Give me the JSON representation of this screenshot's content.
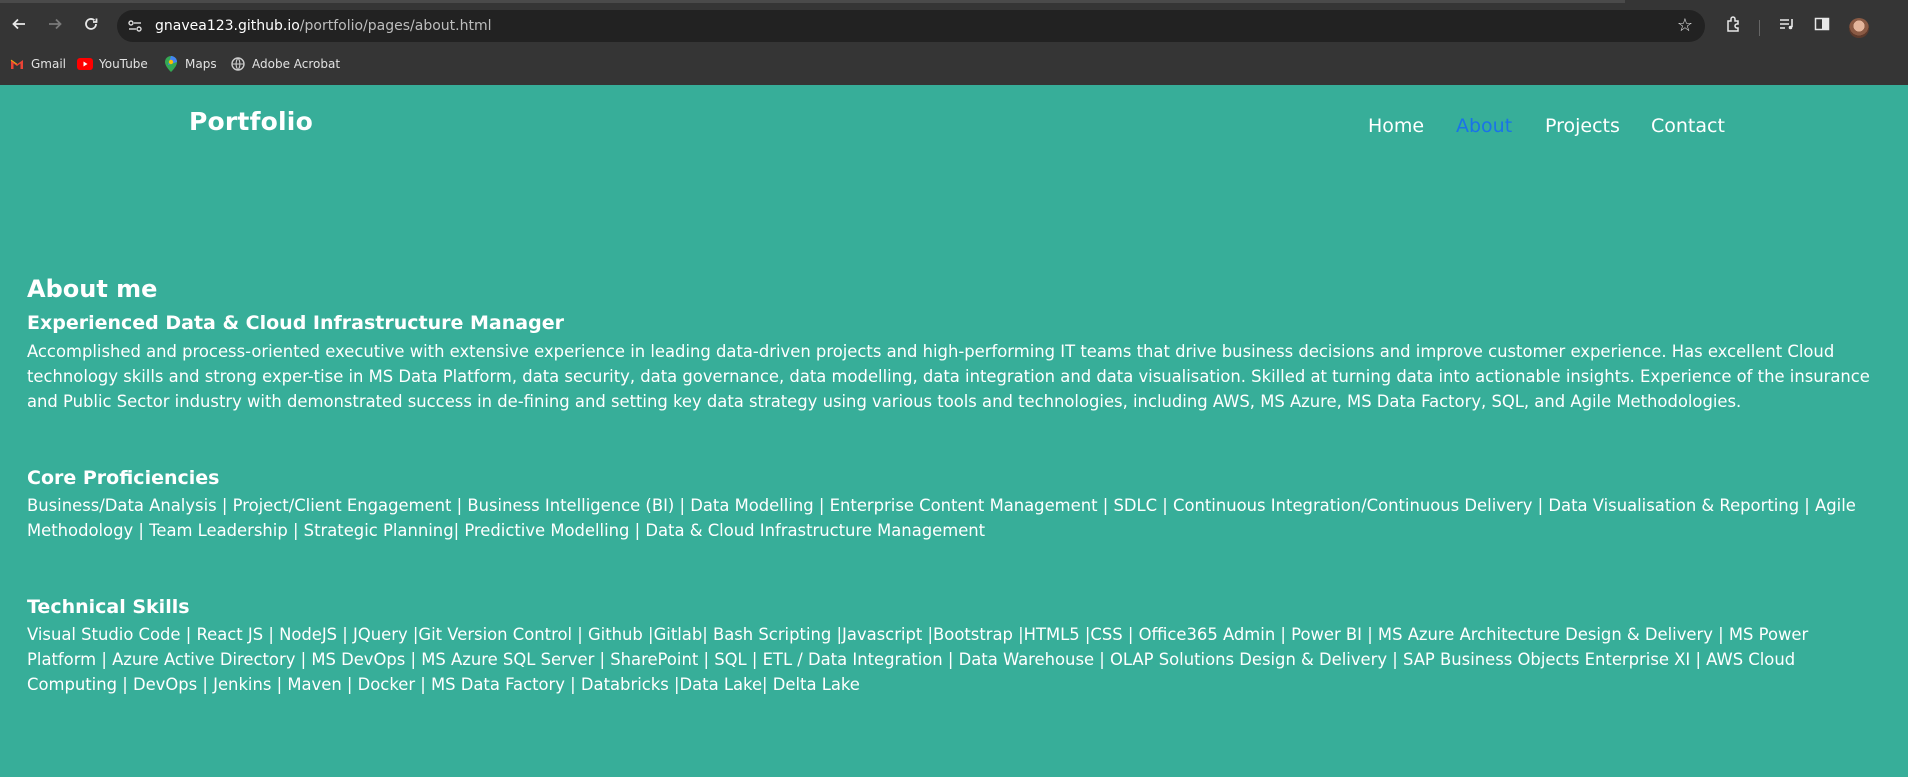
{
  "browser": {
    "url_host": "gnavea123.github.io",
    "url_path": "/portfolio/pages/about.html",
    "bookmarks": [
      {
        "label": "Gmail",
        "icon": "gmail-icon",
        "color": "#ea4335"
      },
      {
        "label": "YouTube",
        "icon": "youtube-icon",
        "color": "#ff0000"
      },
      {
        "label": "Maps",
        "icon": "maps-icon",
        "color": "#34a853"
      },
      {
        "label": "Adobe Acrobat",
        "icon": "globe-icon",
        "color": "#cccccc"
      }
    ]
  },
  "site": {
    "brand": "Portfolio",
    "nav": [
      {
        "label": "Home",
        "active": false
      },
      {
        "label": "About",
        "active": true
      },
      {
        "label": "Projects",
        "active": false
      },
      {
        "label": "Contact",
        "active": false
      }
    ]
  },
  "about": {
    "title": "About me",
    "role": "Experienced Data & Cloud Infrastructure Manager",
    "summary": "Accomplished and process-oriented executive with extensive experience in leading data-driven projects and high-performing IT teams that drive business decisions and improve customer experience. Has excellent Cloud technology skills and strong exper-tise in MS Data Platform, data security, data governance, data modelling, data integration and data visualisation. Skilled at turning data into actionable insights. Experience of the insurance and Public Sector industry with demonstrated success in de-fining and setting key data strategy using various tools and technologies, including AWS, MS Azure, MS Data Factory, SQL, and Agile Methodologies."
  },
  "core": {
    "title": "Core Proficiencies",
    "text": "Business/Data Analysis | Project/Client Engagement | Business Intelligence (BI) | Data Modelling | Enterprise Content Management | SDLC | Continuous Integration/Continuous Delivery | Data Visualisation & Reporting | Agile Methodology | Team Leadership | Strategic Planning| Predictive Modelling | Data & Cloud Infrastructure Management"
  },
  "tech": {
    "title": "Technical Skills",
    "text": "Visual Studio Code | React JS | NodeJS | JQuery |Git Version Control | Github |Gitlab| Bash Scripting |Javascript |Bootstrap |HTML5 |CSS | Office365 Admin | Power BI | MS Azure Architecture Design & Delivery | MS Power Platform | Azure Active Directory | MS DevOps | MS Azure SQL Server | SharePoint | SQL | ETL / Data Integration | Data Warehouse | OLAP Solutions Design & Delivery | SAP Business Objects Enterprise XI | AWS Cloud Computing | DevOps | Jenkins | Maven | Docker | MS Data Factory | Databricks |Data Lake| Delta Lake"
  },
  "colors": {
    "page_background": "#37ae99",
    "active_nav": "#1a73e8",
    "chrome_background": "#353535"
  }
}
